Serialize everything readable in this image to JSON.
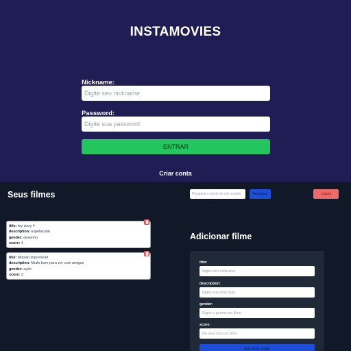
{
  "login": {
    "title": "INSTAMOVIES",
    "nickname_label": "Nickname:",
    "nickname_placeholder": "Digite seu nickname",
    "password_label": "Password:",
    "password_placeholder": "Digite sua password",
    "enter_label": "ENTRAR",
    "create_account_label": "Criar conta"
  },
  "dashboard": {
    "title": "Seus filmes",
    "search_placeholder": "Pesquise o nome de um usuário",
    "search_label": "Pesquisar",
    "logout_label": "Logout",
    "field_labels": {
      "title": "title:",
      "description": "description:",
      "gender": "gender:",
      "score": "score:"
    },
    "movies": [
      {
        "title": "toy story 4",
        "description": "espetacular",
        "gender": "desenho",
        "score": "4"
      },
      {
        "title": "Missão impossível",
        "description": "Muito bom para ver com amigos",
        "gender": "ação",
        "score": "3"
      }
    ],
    "add_form": {
      "heading": "Adicionar filme",
      "title_label": "title:",
      "title_placeholder": "Digite seu nickname",
      "description_label": "description:",
      "description_placeholder": "Digite sua descrição",
      "gender_label": "gender:",
      "gender_placeholder": "Digite o genero do filme",
      "score_label": "score:",
      "score_placeholder": "De uma nota ao filme",
      "submit_label": "Adicionar a lista"
    }
  },
  "icons": {
    "delete": "trash-icon"
  },
  "colors": {
    "login_bg": "#201d54",
    "dashboard_bg": "#111827",
    "enter_button": "#22c55e",
    "primary_button": "#1d4ed8",
    "logout_button": "#f06a6a",
    "delete_button": "#e25555"
  }
}
